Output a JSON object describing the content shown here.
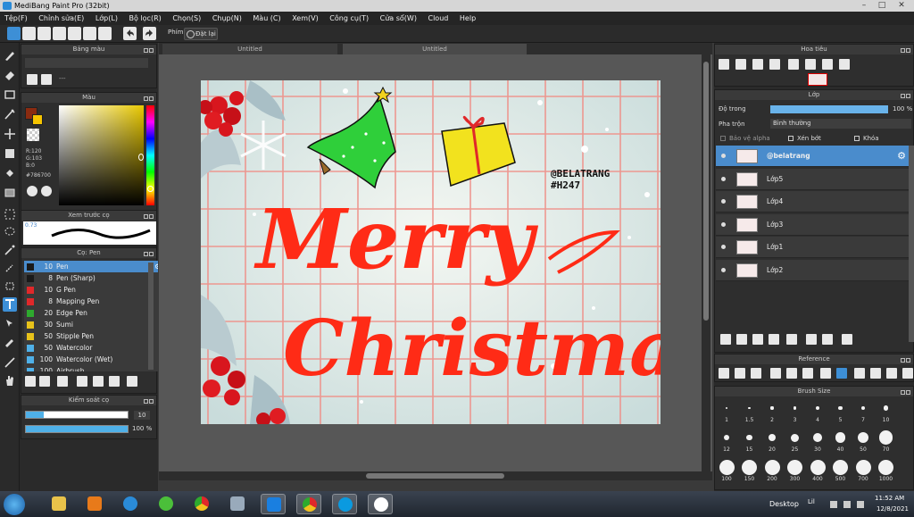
{
  "window": {
    "title": "MediBang Paint Pro (32bit)"
  },
  "menu": [
    "Tệp(F)",
    "Chỉnh sửa(E)",
    "Lớp(L)",
    "Bộ lọc(R)",
    "Chọn(S)",
    "Chụp(N)",
    "Màu (C)",
    "Xem(V)",
    "Công cụ(T)",
    "Cửa sổ(W)",
    "Cloud",
    "Help"
  ],
  "toolbar": {
    "shortcut_label": "Phím",
    "reset_label": "Đặt lại"
  },
  "doc_tabs": [
    "Untitled",
    "Untitled"
  ],
  "panels": {
    "color_palette": {
      "title": "Bảng màu",
      "dash": "---"
    },
    "color": {
      "title": "Màu",
      "r": "R:120",
      "g": "G:103",
      "b": "B:0",
      "hex": "#786700"
    },
    "preview": {
      "title": "Xem trước cọ",
      "size": "0.73"
    },
    "brush": {
      "title": "Cọ: Pen",
      "items": [
        {
          "size": "10",
          "name": "Pen",
          "color": "#1a1a1a"
        },
        {
          "size": "8",
          "name": "Pen (Sharp)",
          "color": "#1a1a1a"
        },
        {
          "size": "10",
          "name": "G Pen",
          "color": "#e0282a"
        },
        {
          "size": "8",
          "name": "Mapping Pen",
          "color": "#e0282a"
        },
        {
          "size": "20",
          "name": "Edge Pen",
          "color": "#2eaa2e"
        },
        {
          "size": "30",
          "name": "Sumi",
          "color": "#e8c21a"
        },
        {
          "size": "50",
          "name": "Stipple Pen",
          "color": "#e8c21a"
        },
        {
          "size": "50",
          "name": "Watercolor",
          "color": "#4fb0e8"
        },
        {
          "size": "100",
          "name": "Watercolor (Wet)",
          "color": "#4fb0e8"
        },
        {
          "size": "100",
          "name": "Airbrush",
          "color": "#4fb0e8"
        }
      ]
    },
    "control": {
      "title": "Kiểm soát cọ",
      "size": "10",
      "opacity": "100 %"
    },
    "navigator": {
      "title": "Hoa tiêu"
    },
    "layer": {
      "title": "Lớp",
      "opacity_label": "Độ trong",
      "opacity_value": "100 %",
      "blend_label": "Pha trộn",
      "blend_value": "Bình thường",
      "protect_alpha": "Bảo vệ alpha",
      "clipping": "Xén bớt",
      "lock": "Khóa",
      "items": [
        "@belatrang",
        "Lớp5",
        "Lớp4",
        "Lớp3",
        "Lớp1",
        "Lớp2"
      ]
    },
    "reference": {
      "title": "Reference"
    },
    "brush_size": {
      "title": "Brush Size",
      "sizes": [
        "1",
        "1.5",
        "2",
        "3",
        "4",
        "5",
        "7",
        "10",
        "12",
        "15",
        "20",
        "25",
        "30",
        "40",
        "50",
        "70",
        "100",
        "150",
        "200",
        "300",
        "400",
        "500",
        "700",
        "1000"
      ]
    }
  },
  "artwork": {
    "title_line1": "Merry",
    "title_line2": "Christmas",
    "handle": "@BELATRANG",
    "tag": "#H247",
    "bg_color": "#dde9e6",
    "grid_color": "#ef8f88",
    "text_color": "#ff2b16"
  },
  "taskbar": {
    "desktop_label": "Desktop",
    "lang": "Lil",
    "time": "11:52 AM",
    "date": "12/8/2021"
  }
}
